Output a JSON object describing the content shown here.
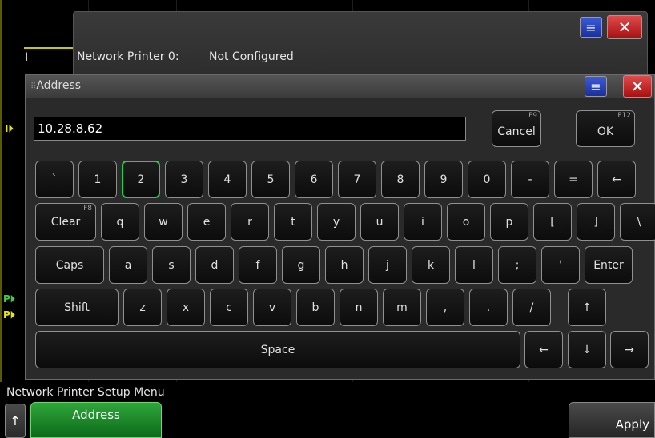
{
  "network_panel": {
    "label": "Network Printer 0:",
    "status": "Not Configured"
  },
  "dialog": {
    "title": "Address",
    "input_value": "10.28.8.62",
    "cancel": {
      "label": "Cancel",
      "fkey": "F9"
    },
    "ok": {
      "label": "OK",
      "fkey": "F12"
    }
  },
  "keyboard": {
    "row1": [
      "`",
      "1",
      "2",
      "3",
      "4",
      "5",
      "6",
      "7",
      "8",
      "9",
      "0",
      "-",
      "=",
      "←"
    ],
    "row2": [
      "Clear",
      "q",
      "w",
      "e",
      "r",
      "t",
      "y",
      "u",
      "i",
      "o",
      "p",
      "[",
      "]",
      "\\"
    ],
    "row2_clear_fkey": "F8",
    "row3": [
      "Caps",
      "a",
      "s",
      "d",
      "f",
      "g",
      "h",
      "j",
      "k",
      "l",
      ";",
      "'",
      "Enter"
    ],
    "row4": [
      "Shift",
      "z",
      "x",
      "c",
      "v",
      "b",
      "n",
      "m",
      ",",
      ".",
      "/",
      "↑"
    ],
    "row5": [
      "Space",
      "←",
      "↓",
      "→"
    ]
  },
  "menu": {
    "title": "Network Printer Setup Menu",
    "address_button": "Address",
    "apply_button": "Apply",
    "up_icon": "↑"
  },
  "icons": {
    "menu": "≡",
    "close": "✕",
    "drag": "⠿"
  }
}
